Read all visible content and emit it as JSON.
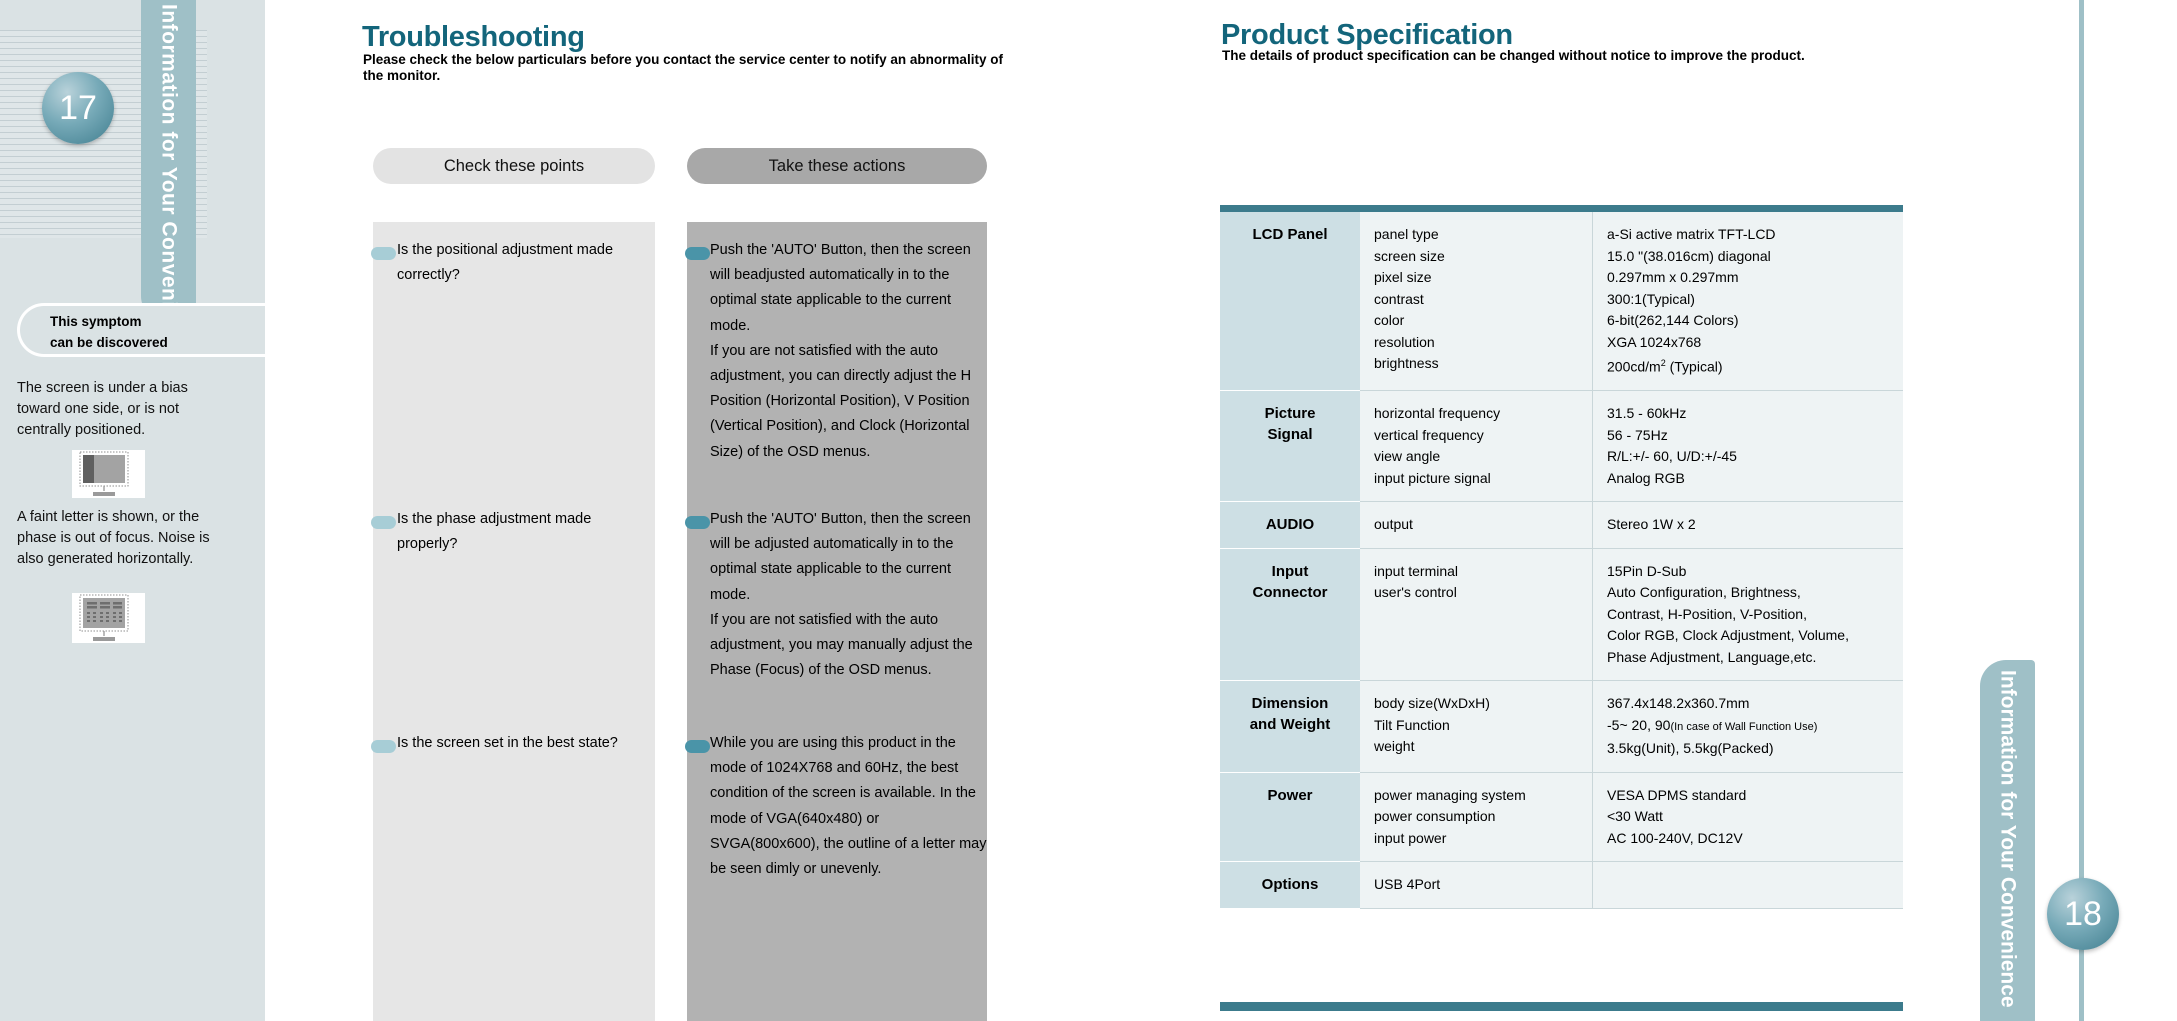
{
  "left_page": {
    "page_number": "17",
    "tab_label": "Information for Your Convenience",
    "symptom_box": {
      "line1": "This symptom",
      "line2": "can be discovered"
    },
    "symptom_paragraphs": [
      "The screen is under a bias toward one side, or is not centrally positioned.",
      "A faint letter is  shown, or the phase  is out of  focus. Noise is also  generated horizontally."
    ],
    "thumbnails": [
      "monitor-bias-thumbnail",
      "monitor-noise-thumbnail"
    ]
  },
  "troubleshooting": {
    "title": "Troubleshooting",
    "subtitle": "Please check  the below  particulars before   you contact the  service center to notify an abnormality of the monitor.",
    "column_headers": {
      "check": "Check these points",
      "action": "Take these actions"
    },
    "rows": [
      {
        "check": "Is the positional adjustment made correctly?",
        "action": "Push  the 'AUTO' Button, then the screen  will beadjusted  automatically in to the  optimal state applicable to the current mode.\nIf  you are  not satisfied   with the auto adjustment,  you can  directly adjust the H Position (Horizontal Position),  V Position (Vertical Position),  and Clock (Horizontal Size) of the OSD menus."
      },
      {
        "check": "Is the phase adjustment made properly?",
        "action": "Push  the 'AUTO' Button, then the screen  will be adjusted  automatically in to the  optimal state applicable to the current mode.\n If you   are not satisfied  with  the auto adjustment, you may  manually adjust the Phase (Focus) of the OSD menus."
      },
      {
        "check": "Is the screen set in the best state?",
        "action": " While you are using this product in the mode of 1024X768 and 60Hz, the best condition  of  the screen is available.  In  the  mode of   VGA(640x480) or SVGA(800x600), the outline of a letter may be seen dimly or unevenly."
      }
    ]
  },
  "product_specification": {
    "title": "Product Specification",
    "subtitle": "The details of product  specification can be  changed without notice  to improve the product.",
    "table": {
      "rows": [
        {
          "category": "LCD Panel",
          "keys": [
            "panel  type",
            "screen  size",
            "pixel size",
            "contrast",
            "color",
            "resolution",
            "brightness"
          ],
          "values": [
            "a-Si active matrix TFT-LCD",
            "15.0 \"(38.016cm) diagonal",
            "0.297mm x 0.297mm",
            "300:1(Typical)",
            "6-bit(262,144 Colors)",
            "XGA 1024x768",
            "200cd/m2 (Typical)"
          ]
        },
        {
          "category": "Picture Signal",
          "keys": [
            "horizontal frequency",
            "vertical frequency",
            "view angle",
            "input picture signal"
          ],
          "values": [
            "31.5 - 60kHz",
            "56 - 75Hz",
            "R/L:+/- 60, U/D:+/-45",
            "Analog RGB"
          ]
        },
        {
          "category": "AUDIO",
          "keys": [
            "output"
          ],
          "values": [
            "Stereo 1W x 2"
          ]
        },
        {
          "category": "Input Connector",
          "keys": [
            "input terminal",
            "user's control"
          ],
          "values": [
            "15Pin D-Sub",
            "Auto Configuration, Brightness,",
            "Contrast, H-Position, V-Position,",
            "Color RGB, Clock Adjustment, Volume,",
            "Phase Adjustment, Language,etc."
          ]
        },
        {
          "category": "Dimension and Weight",
          "keys": [
            "body size(WxDxH)",
            "Tilt Function",
            "weight"
          ],
          "values": [
            "367.4x148.2x360.7mm",
            "-5~ 20, 90(In case of Wall Function Use)",
            "3.5kg(Unit), 5.5kg(Packed)"
          ]
        },
        {
          "category": "Power",
          "keys": [
            "power managing system",
            "power consumption",
            "input power"
          ],
          "values": [
            "VESA DPMS standard",
            " <30 Watt",
            "AC 100-240V, DC12V"
          ]
        },
        {
          "category": "Options",
          "keys": [
            "USB 4Port"
          ],
          "values": [
            ""
          ]
        }
      ]
    }
  },
  "right_page": {
    "page_number": "18",
    "tab_label": "Information for Your Convenience"
  },
  "colors": {
    "accent_teal": "#13657b",
    "tab_blue": "#9fc0c7",
    "panel_light": "#e6e6e6",
    "panel_dark": "#b2b2b2",
    "table_header_bar": "#3c7b8c",
    "table_cat_bg": "#cddfe4",
    "table_cell_bg": "#eef3f4",
    "page_bg": "#dae2e4"
  }
}
